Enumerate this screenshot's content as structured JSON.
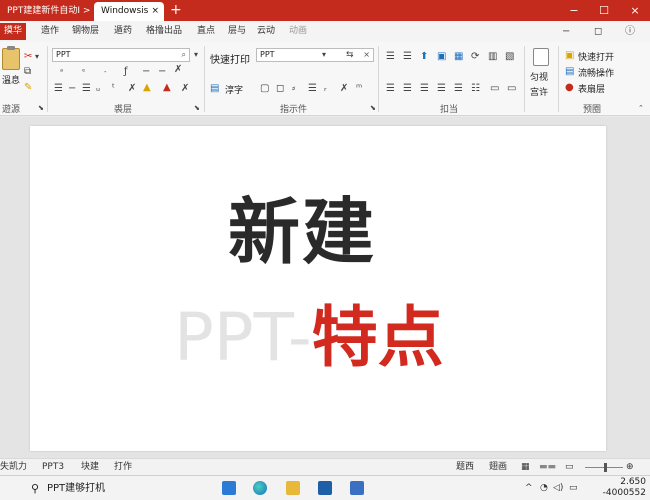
{
  "titlebar": {
    "tabs": [
      {
        "label": "PPT建建新件自动I >",
        "close": "×"
      },
      {
        "label": "Windowsis",
        "close": "×"
      }
    ],
    "new_tab": "+",
    "controls": {
      "min": "−",
      "max": "☐",
      "close": "×"
    }
  },
  "menubar": {
    "file": "摸华",
    "items": [
      "造作",
      "钢物层",
      "遁药",
      "格撸出品",
      "直点",
      "层与",
      "云动",
      "动画"
    ],
    "right": {
      "minimize": "−",
      "restore": "◻",
      "help": "ⓘ"
    }
  },
  "ribbon": {
    "clipboard": {
      "paste_label": "溫息",
      "group_label": "遊源"
    },
    "font": {
      "font_combo": "PPT",
      "group_label": "裘层"
    },
    "paragraph": {
      "quick_label": "快速打印",
      "font_combo": "PPT",
      "convert_label": "淳字",
      "group_label": "指示件"
    },
    "arrange": {
      "group_label": "扣当"
    },
    "editing": {
      "line1": "匀视",
      "line2": "宫许"
    },
    "quick": {
      "item1": "快速打开",
      "item2": "流畅操作",
      "item3": "表扇层",
      "group_label": "预圈"
    }
  },
  "slide": {
    "line1": "新建",
    "line2_gray": "PPT-",
    "line2_red": "特点",
    "colors": {
      "dark": "#2a2a2a",
      "red": "#d22a1f",
      "gray": "#e3e3e3"
    }
  },
  "statusbar": {
    "items": [
      "失凯力",
      "PPT3",
      "块建",
      "打作"
    ],
    "view_label": "题西",
    "view_label2": "翅画"
  },
  "taskbar": {
    "search_text": "PPT建够打机",
    "tray_chevron": "^",
    "time": "2.650",
    "date": "-4000552"
  }
}
